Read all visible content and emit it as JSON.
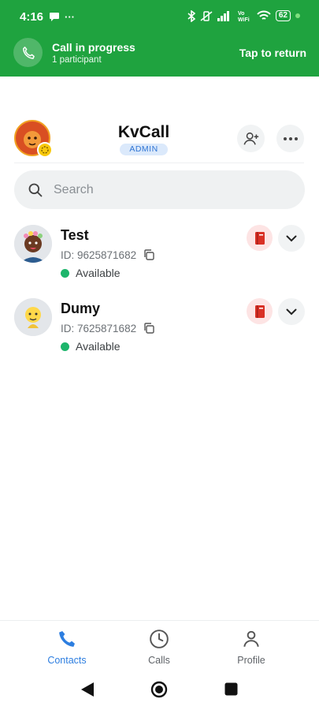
{
  "status_bar": {
    "time": "4:16",
    "battery": "62",
    "extra": "···"
  },
  "call_banner": {
    "title": "Call in progress",
    "subtitle": "1 participant",
    "action": "Tap to return"
  },
  "header": {
    "app_title": "KvCall",
    "role_badge": "ADMIN"
  },
  "search": {
    "placeholder": "Search"
  },
  "contacts": [
    {
      "name": "Test",
      "id": "ID: 9625871682",
      "status": "Available"
    },
    {
      "name": "Dumy",
      "id": "ID: 7625871682",
      "status": "Available"
    }
  ],
  "bottom_nav": {
    "items": [
      {
        "label": "Contacts"
      },
      {
        "label": "Calls"
      },
      {
        "label": "Profile"
      }
    ]
  },
  "colors": {
    "accent": "#2d7ee0",
    "banner": "#1fa33f",
    "available": "#1db56b"
  }
}
